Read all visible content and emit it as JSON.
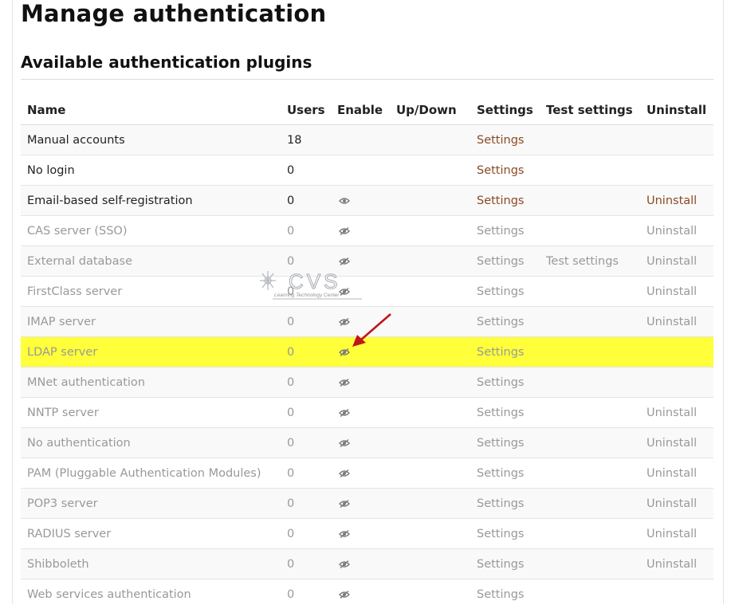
{
  "page": {
    "title": "Manage authentication",
    "section_title": "Available authentication plugins"
  },
  "table": {
    "headers": {
      "name": "Name",
      "users": "Users",
      "enable": "Enable",
      "updown": "Up/Down",
      "settings": "Settings",
      "test": "Test settings",
      "uninstall": "Uninstall"
    },
    "rows": [
      {
        "name": "Manual accounts",
        "users": "18",
        "enabled": null,
        "settings": "Settings",
        "test": "",
        "uninstall": "",
        "state": "active"
      },
      {
        "name": "No login",
        "users": "0",
        "enabled": null,
        "settings": "Settings",
        "test": "",
        "uninstall": "",
        "state": "active"
      },
      {
        "name": "Email-based self-registration",
        "users": "0",
        "enabled": "eye-icon",
        "settings": "Settings",
        "test": "",
        "uninstall": "Uninstall",
        "state": "active"
      },
      {
        "name": "CAS server (SSO)",
        "users": "0",
        "enabled": "eye-slash-icon",
        "settings": "Settings",
        "test": "",
        "uninstall": "Uninstall",
        "state": "disabled"
      },
      {
        "name": "External database",
        "users": "0",
        "enabled": "eye-slash-icon",
        "settings": "Settings",
        "test": "Test settings",
        "uninstall": "Uninstall",
        "state": "disabled"
      },
      {
        "name": "FirstClass server",
        "users": "0",
        "enabled": "eye-slash-icon",
        "settings": "Settings",
        "test": "",
        "uninstall": "Uninstall",
        "state": "disabled"
      },
      {
        "name": "IMAP server",
        "users": "0",
        "enabled": "eye-slash-icon",
        "settings": "Settings",
        "test": "",
        "uninstall": "Uninstall",
        "state": "disabled"
      },
      {
        "name": "LDAP server",
        "users": "0",
        "enabled": "eye-slash-icon",
        "settings": "Settings",
        "test": "",
        "uninstall": "",
        "state": "highlighted"
      },
      {
        "name": "MNet authentication",
        "users": "0",
        "enabled": "eye-slash-icon",
        "settings": "Settings",
        "test": "",
        "uninstall": "",
        "state": "disabled"
      },
      {
        "name": "NNTP server",
        "users": "0",
        "enabled": "eye-slash-icon",
        "settings": "Settings",
        "test": "",
        "uninstall": "Uninstall",
        "state": "disabled"
      },
      {
        "name": "No authentication",
        "users": "0",
        "enabled": "eye-slash-icon",
        "settings": "Settings",
        "test": "",
        "uninstall": "Uninstall",
        "state": "disabled"
      },
      {
        "name": "PAM (Pluggable Authentication Modules)",
        "users": "0",
        "enabled": "eye-slash-icon",
        "settings": "Settings",
        "test": "",
        "uninstall": "Uninstall",
        "state": "disabled"
      },
      {
        "name": "POP3 server",
        "users": "0",
        "enabled": "eye-slash-icon",
        "settings": "Settings",
        "test": "",
        "uninstall": "Uninstall",
        "state": "disabled"
      },
      {
        "name": "RADIUS server",
        "users": "0",
        "enabled": "eye-slash-icon",
        "settings": "Settings",
        "test": "",
        "uninstall": "Uninstall",
        "state": "disabled"
      },
      {
        "name": "Shibboleth",
        "users": "0",
        "enabled": "eye-slash-icon",
        "settings": "Settings",
        "test": "",
        "uninstall": "Uninstall",
        "state": "disabled"
      },
      {
        "name": "Web services authentication",
        "users": "0",
        "enabled": "eye-slash-icon",
        "settings": "Settings",
        "test": "",
        "uninstall": "",
        "state": "disabled"
      }
    ]
  },
  "watermark": {
    "text": "CVS",
    "subtext": "Learning Technology Center"
  },
  "colors": {
    "link": "#8a4a24",
    "disabled": "#999999",
    "highlight": "#ffff3a",
    "arrow": "#c0141b"
  }
}
